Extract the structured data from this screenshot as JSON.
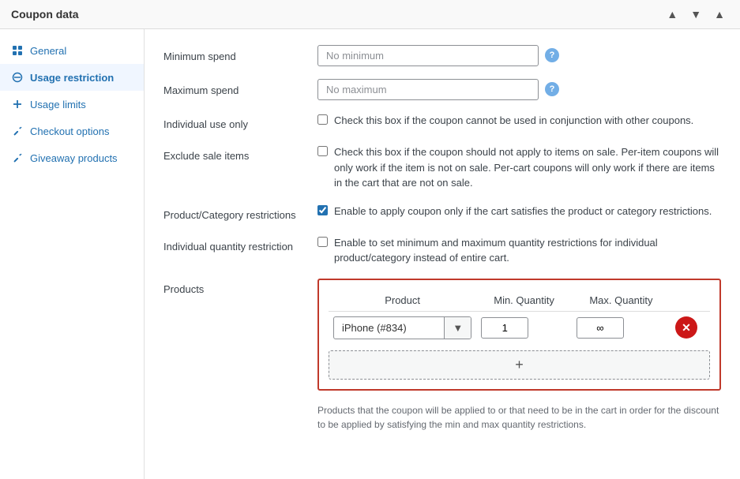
{
  "titleBar": {
    "title": "Coupon data",
    "controls": [
      "▲",
      "▼",
      "▲"
    ]
  },
  "sidebar": {
    "items": [
      {
        "id": "general",
        "label": "General",
        "icon": "grid",
        "active": false
      },
      {
        "id": "usage-restriction",
        "label": "Usage restriction",
        "icon": "block",
        "active": true
      },
      {
        "id": "usage-limits",
        "label": "Usage limits",
        "icon": "plus",
        "active": false
      },
      {
        "id": "checkout-options",
        "label": "Checkout options",
        "icon": "wrench",
        "active": false
      },
      {
        "id": "giveaway-products",
        "label": "Giveaway products",
        "icon": "wrench2",
        "active": false
      }
    ]
  },
  "form": {
    "minimumSpend": {
      "label": "Minimum spend",
      "placeholder": "No minimum"
    },
    "maximumSpend": {
      "label": "Maximum spend",
      "placeholder": "No maximum"
    },
    "individualUseOnly": {
      "label": "Individual use only",
      "checkboxLabel": "Check this box if the coupon cannot be used in conjunction with other coupons.",
      "checked": false
    },
    "excludeSaleItems": {
      "label": "Exclude sale items",
      "checkboxLabel": "Check this box if the coupon should not apply to items on sale. Per-item coupons will only work if the item is not on sale. Per-cart coupons will only work if there are items in the cart that are not on sale.",
      "checked": false
    },
    "productCategoryRestrictions": {
      "label": "Product/Category restrictions",
      "checkboxLabel": "Enable to apply coupon only if the cart satisfies the product or category restrictions.",
      "checked": true
    },
    "individualQuantityRestriction": {
      "label": "Individual quantity restriction",
      "checkboxLabel": "Enable to set minimum and maximum quantity restrictions for individual product/category instead of entire cart.",
      "checked": false
    },
    "products": {
      "label": "Products",
      "tableHeaders": {
        "product": "Product",
        "minQuantity": "Min. Quantity",
        "maxQuantity": "Max. Quantity"
      },
      "rows": [
        {
          "product": "iPhone (#834)",
          "minQuantity": "1",
          "maxQuantity": "∞"
        }
      ],
      "addButtonLabel": "+",
      "description": "Products that the coupon will be applied to or that need to be in the cart in order for the discount to be applied by satisfying the min and max quantity restrictions."
    }
  }
}
